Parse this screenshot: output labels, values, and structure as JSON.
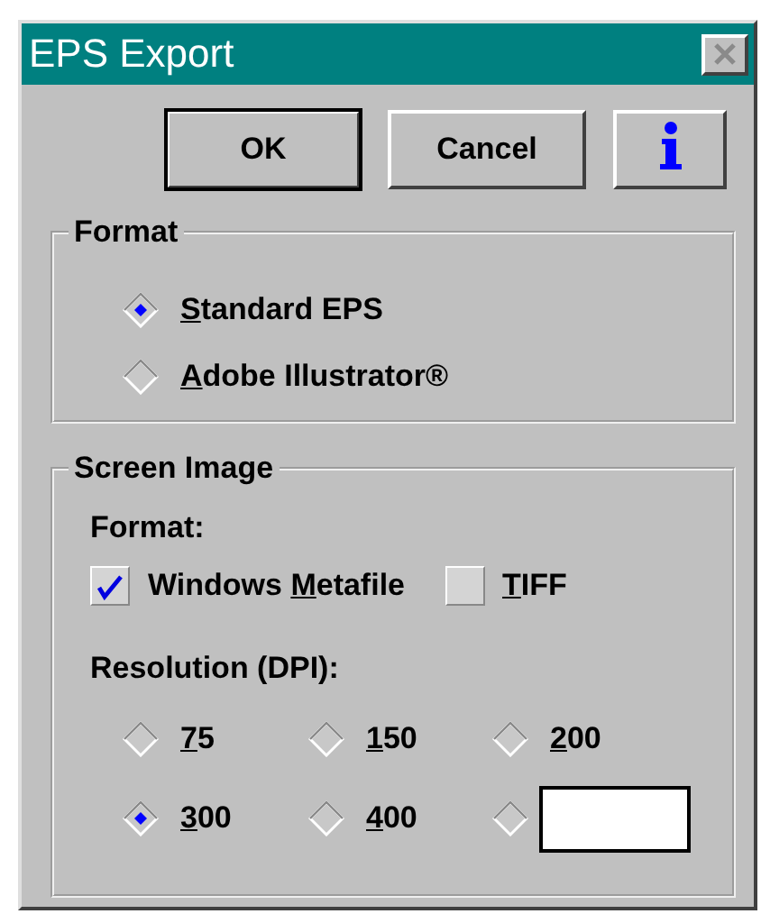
{
  "window": {
    "title": "EPS Export",
    "close_disabled": true
  },
  "buttons": [
    {
      "kind": "default",
      "label": "OK"
    },
    {
      "kind": "normal",
      "label": "Cancel"
    },
    {
      "kind": "info"
    }
  ],
  "format": {
    "title": "Format",
    "options": [
      {
        "label": [
          {
            "text": "S",
            "underlined": true
          },
          {
            "text": "tandard EPS",
            "underlined": false
          }
        ],
        "selected": true
      },
      {
        "label": [
          {
            "text": "A",
            "underlined": true
          },
          {
            "text": "dobe Illustrator®",
            "underlined": false
          }
        ],
        "selected": false
      }
    ]
  },
  "screen_image": {
    "title": "Screen Image",
    "format_label": "Format:",
    "formats": [
      {
        "label": [
          {
            "text": "Windows ",
            "underlined": false
          },
          {
            "text": "M",
            "underlined": true
          },
          {
            "text": "etafile",
            "underlined": false
          }
        ],
        "checked": true
      },
      {
        "label": [
          {
            "text": "T",
            "underlined": true
          },
          {
            "text": "IFF",
            "underlined": false
          }
        ],
        "checked": false
      }
    ],
    "resolution_label": "Resolution (DPI):",
    "resolutions": [
      {
        "kind": "option",
        "label": [
          {
            "text": "7",
            "underlined": true
          },
          {
            "text": "5",
            "underlined": false
          }
        ],
        "selected": false
      },
      {
        "kind": "option",
        "label": [
          {
            "text": "1",
            "underlined": true
          },
          {
            "text": "50",
            "underlined": false
          }
        ],
        "selected": false
      },
      {
        "kind": "option",
        "label": [
          {
            "text": "2",
            "underlined": true
          },
          {
            "text": "00",
            "underlined": false
          }
        ],
        "selected": false
      },
      {
        "kind": "option",
        "label": [
          {
            "text": "3",
            "underlined": true
          },
          {
            "text": "00",
            "underlined": false
          }
        ],
        "selected": true
      },
      {
        "kind": "option",
        "label": [
          {
            "text": "4",
            "underlined": true
          },
          {
            "text": "00",
            "underlined": false
          }
        ],
        "selected": false
      },
      {
        "kind": "custom",
        "selected": false
      }
    ]
  }
}
